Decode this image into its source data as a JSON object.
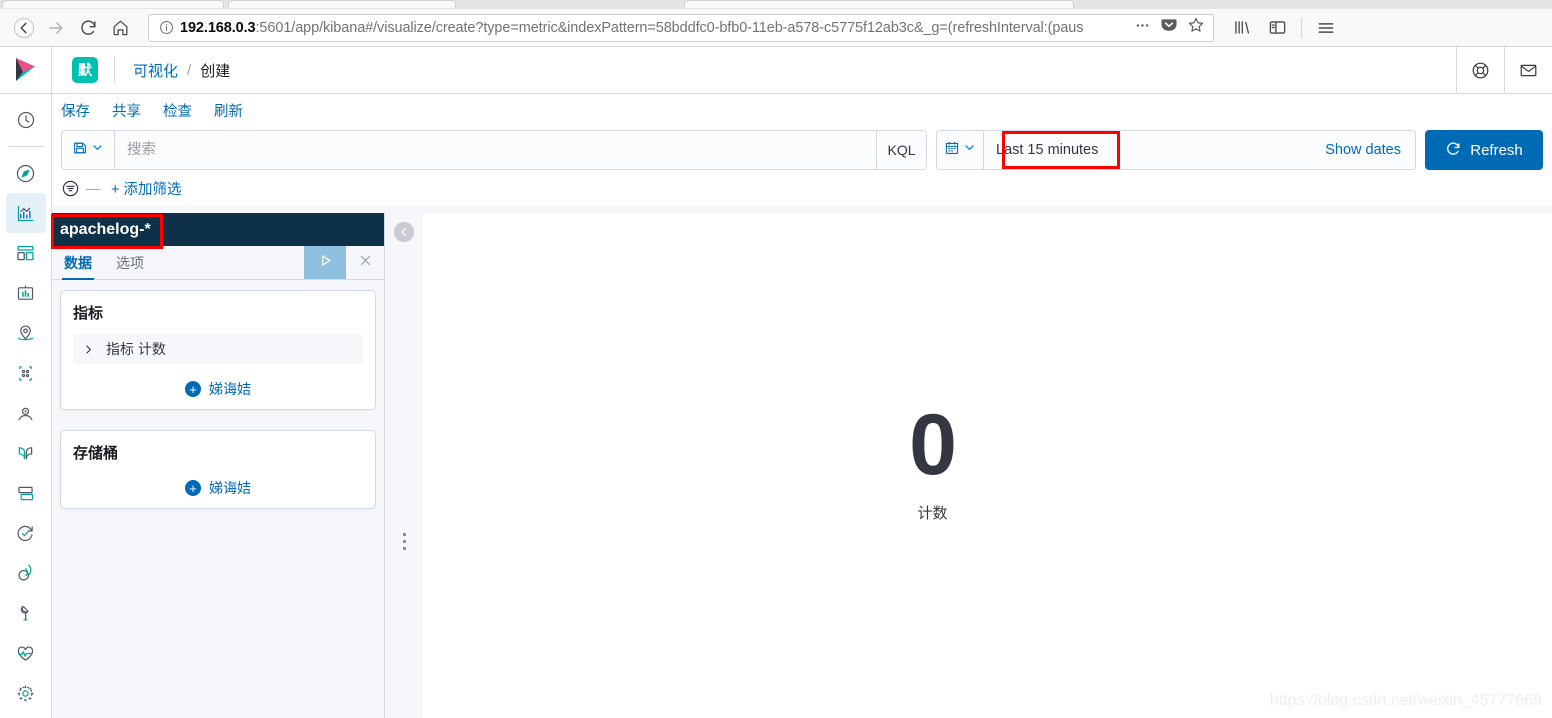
{
  "browser": {
    "url_host": "192.168.0.3",
    "url_rest": ":5601/app/kibana#/visualize/create?type=metric&indexPattern=58bddfc0-bfb0-11eb-a578-c5775f12ab3c&_g=(refreshInterval:(paus",
    "back_icon": "back-arrow-icon",
    "forward_icon": "forward-arrow-icon",
    "reload_icon": "reload-icon",
    "home_icon": "home-icon",
    "info_icon": "page-info-icon",
    "ellipsis_icon": "page-actions-icon",
    "pocket_icon": "pocket-icon",
    "bookmark_icon": "star-bookmark-icon",
    "library_icon": "library-icon",
    "sidebar_icon": "sidebar-toggle-icon",
    "menu_icon": "hamburger-menu-icon"
  },
  "kibana_header": {
    "logo": "kibana-logo",
    "space_badge": "默",
    "breadcrumb": [
      {
        "label": "可视化",
        "current": false
      },
      {
        "label": "创建",
        "current": true
      }
    ],
    "breadcrumb_separator": "/",
    "help_icon": "help-lifebuoy-icon",
    "news_icon": "newsfeed-envelope-icon"
  },
  "nav_rail": {
    "items": [
      {
        "name": "recently-viewed",
        "icon": "clock-icon",
        "active": false
      },
      {
        "name": "discover",
        "icon": "compass-icon",
        "active": false
      },
      {
        "name": "visualize",
        "icon": "bar-chart-icon",
        "active": true
      },
      {
        "name": "dashboard",
        "icon": "dashboard-icon",
        "active": false
      },
      {
        "name": "canvas",
        "icon": "canvas-icon",
        "active": false
      },
      {
        "name": "maps",
        "icon": "map-marker-icon",
        "active": false
      },
      {
        "name": "machine-learning",
        "icon": "machine-learning-icon",
        "active": false
      },
      {
        "name": "infrastructure",
        "icon": "user-icon",
        "active": false
      },
      {
        "name": "logs",
        "icon": "logs-icon",
        "active": false
      },
      {
        "name": "metrics",
        "icon": "metrics-icon",
        "active": false
      },
      {
        "name": "uptime",
        "icon": "uptime-clock-icon",
        "active": false
      },
      {
        "name": "apm",
        "icon": "apm-signal-icon",
        "active": false
      },
      {
        "name": "dev-tools",
        "icon": "wrench-icon",
        "active": false
      },
      {
        "name": "stack-monitoring",
        "icon": "heartbeat-icon",
        "active": false
      },
      {
        "name": "management",
        "icon": "gear-icon",
        "active": false
      }
    ]
  },
  "vis_actions": [
    {
      "label": "保存"
    },
    {
      "label": "共享"
    },
    {
      "label": "检查"
    },
    {
      "label": "刷新"
    }
  ],
  "query_bar": {
    "saved_query_icon": "saved-query-disk-icon",
    "saved_query_chevron": "chevron-down-icon",
    "search_placeholder": "搜索",
    "search_value": "",
    "language_badge": "KQL",
    "date_icon": "calendar-icon",
    "date_chevron": "chevron-down-icon",
    "date_range": "Last 15 minutes",
    "show_dates_label": "Show dates",
    "refresh_label": "Refresh",
    "refresh_icon": "refresh-circle-icon"
  },
  "filter_bar": {
    "filter_icon": "filter-funnel-icon",
    "dash": "—",
    "add_filter_label": "+ 添加筛选"
  },
  "side_panel": {
    "index_pattern": "apachelog-*",
    "tabs": [
      {
        "label": "数据",
        "active": true
      },
      {
        "label": "选项",
        "active": false
      }
    ],
    "apply_icon": "apply-play-icon",
    "close_icon": "close-x-icon",
    "metrics_section": {
      "title": "指标",
      "rows": [
        {
          "expand_icon": "chevron-right-icon",
          "label": "指标 计数"
        }
      ],
      "add_label": "娣诲姞"
    },
    "buckets_section": {
      "title": "存储桶",
      "add_label": "娣诲姞"
    },
    "collapse_icon": "collapse-left-chevron-icon",
    "drag_handle": "panel-resize-handle"
  },
  "visualization": {
    "metric_value": "0",
    "metric_label": "计数"
  },
  "watermark": "https://blog.csdn.net/weixin_45777669",
  "colors": {
    "accent_blue": "#006bb4",
    "teal": "#00bfb3",
    "dark_navy": "#0f3049",
    "annotation_red": "#ff0000"
  }
}
